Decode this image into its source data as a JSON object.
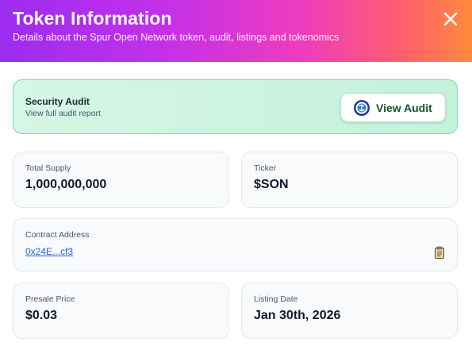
{
  "header": {
    "title": "Token Information",
    "subtitle": "Details about the Spur Open Network token, audit, listings and tokenomics"
  },
  "audit": {
    "title": "Security Audit",
    "subtitle": "View full audit report",
    "button_label": "View Audit"
  },
  "total_supply": {
    "label": "Total Supply",
    "value": "1,000,000,000"
  },
  "ticker": {
    "label": "Ticker",
    "value": "$SON"
  },
  "contract": {
    "label": "Contract Address",
    "value": "0x24E...cf3"
  },
  "presale_price": {
    "label": "Presale Price",
    "value": "$0.03"
  },
  "listing_date": {
    "label": "Listing Date",
    "value": "Jan 30th, 2026"
  },
  "colors": {
    "accent_green": "#14532d",
    "link_blue": "#2563eb",
    "header_gradient_start": "#9b2cf0",
    "header_gradient_end": "#ff8a3d"
  },
  "icons": {
    "close": "close-icon",
    "audit": "audit-badge-icon",
    "copy": "clipboard-icon"
  }
}
